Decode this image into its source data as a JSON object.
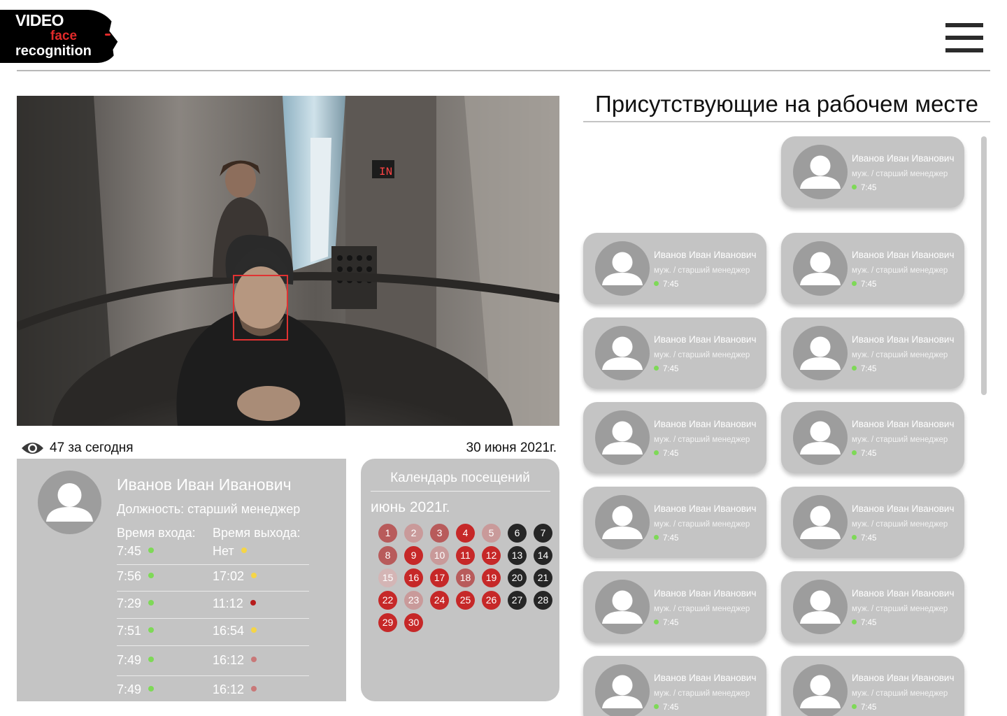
{
  "header": {
    "logo": {
      "line1": "VIDEO",
      "line2": "face",
      "line3": "recognition"
    },
    "menu_icon": "hamburger-menu-icon"
  },
  "camera": {
    "counter_icon": "eye-icon",
    "counter_text": "47 за сегодня",
    "date": "30 июня 2021г.",
    "display_text": "IN"
  },
  "person": {
    "name": "Иванов Иван Иванович",
    "position": "Должность: старший менеджер",
    "entry_label": "Время входа:",
    "exit_label": "Время выхода:",
    "rows": [
      {
        "in": "7:45",
        "in_color": "#7ed957",
        "out": "Нет",
        "out_color": "#f5d547"
      },
      {
        "in": "7:56",
        "in_color": "#7ed957",
        "out": "17:02",
        "out_color": "#f5d547"
      },
      {
        "in": "7:29",
        "in_color": "#7ed957",
        "out": "11:12",
        "out_color": "#b71c1c"
      },
      {
        "in": "7:51",
        "in_color": "#7ed957",
        "out": "16:54",
        "out_color": "#f5d547"
      },
      {
        "in": "7:49",
        "in_color": "#7ed957",
        "out": "16:12",
        "out_color": "#c97878"
      },
      {
        "in": "7:49",
        "in_color": "#7ed957",
        "out": "16:12",
        "out_color": "#c97878"
      }
    ]
  },
  "calendar": {
    "title": "Календарь посещений",
    "month": "июнь 2021г.",
    "colors": {
      "red": "#c62828",
      "mid": "#b85b5b",
      "light": "#c99a9a",
      "pale": "#d4b5b5",
      "dark": "#262626"
    },
    "days": [
      {
        "d": "1",
        "c": "mid"
      },
      {
        "d": "2",
        "c": "light"
      },
      {
        "d": "3",
        "c": "mid"
      },
      {
        "d": "4",
        "c": "red"
      },
      {
        "d": "5",
        "c": "light"
      },
      {
        "d": "6",
        "c": "dark"
      },
      {
        "d": "7",
        "c": "dark"
      },
      {
        "d": "8",
        "c": "mid"
      },
      {
        "d": "9",
        "c": "red"
      },
      {
        "d": "10",
        "c": "light"
      },
      {
        "d": "11",
        "c": "red"
      },
      {
        "d": "12",
        "c": "red"
      },
      {
        "d": "13",
        "c": "dark"
      },
      {
        "d": "14",
        "c": "dark"
      },
      {
        "d": "15",
        "c": "pale"
      },
      {
        "d": "16",
        "c": "red"
      },
      {
        "d": "17",
        "c": "red"
      },
      {
        "d": "18",
        "c": "mid"
      },
      {
        "d": "19",
        "c": "red"
      },
      {
        "d": "20",
        "c": "dark"
      },
      {
        "d": "21",
        "c": "dark"
      },
      {
        "d": "22",
        "c": "red"
      },
      {
        "d": "23",
        "c": "light"
      },
      {
        "d": "24",
        "c": "red"
      },
      {
        "d": "25",
        "c": "red"
      },
      {
        "d": "26",
        "c": "red"
      },
      {
        "d": "27",
        "c": "dark"
      },
      {
        "d": "28",
        "c": "dark"
      },
      {
        "d": "29",
        "c": "red"
      },
      {
        "d": "30",
        "c": "red"
      }
    ]
  },
  "present": {
    "title": "Присутствующие на рабочем месте",
    "status_color": "#7ed957",
    "cards": [
      {
        "name": "Иванов Иван Иванович",
        "position": "муж. / старший менеджер",
        "time": "7:45"
      },
      {
        "name": "Иванов Иван Иванович",
        "position": "муж. / старший менеджер",
        "time": "7:45"
      },
      {
        "name": "Иванов Иван Иванович",
        "position": "муж. / старший менеджер",
        "time": "7:45"
      },
      {
        "name": "Иванов Иван Иванович",
        "position": "муж. / старший менеджер",
        "time": "7:45"
      },
      {
        "name": "Иванов Иван Иванович",
        "position": "муж. / старший менеджер",
        "time": "7:45"
      },
      {
        "name": "Иванов Иван Иванович",
        "position": "муж. / старший менеджер",
        "time": "7:45"
      },
      {
        "name": "Иванов Иван Иванович",
        "position": "муж. / старший менеджер",
        "time": "7:45"
      },
      {
        "name": "Иванов Иван Иванович",
        "position": "муж. / старший менеджер",
        "time": "7:45"
      },
      {
        "name": "Иванов Иван Иванович",
        "position": "муж. / старший менеджер",
        "time": "7:45"
      },
      {
        "name": "Иванов Иван Иванович",
        "position": "муж. / старший менеджер",
        "time": "7:45"
      },
      {
        "name": "Иванов Иван Иванович",
        "position": "муж. / старший менеджер",
        "time": "7:45"
      },
      {
        "name": "Иванов Иван Иванович",
        "position": "муж. / старший менеджер",
        "time": "7:45"
      },
      {
        "name": "Иванов Иван Иванович",
        "position": "муж. / старший менеджер",
        "time": "7:45"
      }
    ]
  }
}
